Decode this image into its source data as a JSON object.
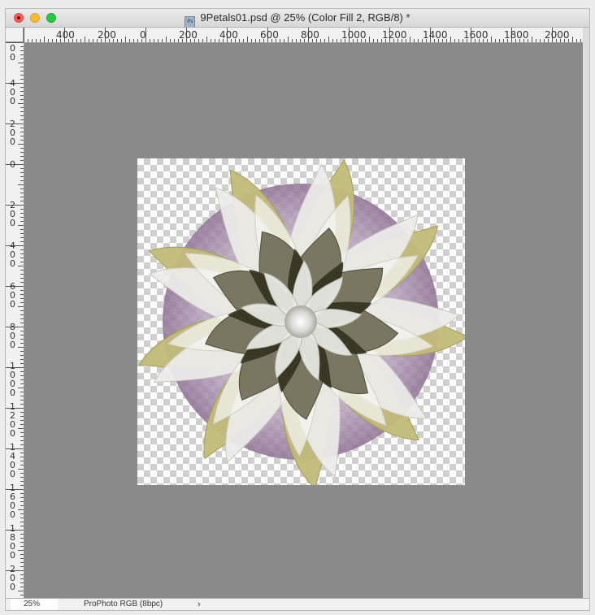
{
  "window": {
    "title": "9Petals01.psd @ 25% (Color Fill 2, RGB/8) *",
    "doc_icon": "photoshop-document-icon"
  },
  "ruler_horizontal": [
    "400",
    "200",
    "0",
    "200",
    "400",
    "600",
    "800",
    "1000",
    "1200",
    "1400",
    "1600",
    "1800",
    "2000"
  ],
  "ruler_vertical": [
    "00",
    "400",
    "200",
    "0",
    "200",
    "400",
    "600",
    "800",
    "1000",
    "1200",
    "1400",
    "1600",
    "1800",
    "200"
  ],
  "statusbar": {
    "zoom": "25%",
    "color_profile": "ProPhoto RGB (8bpc)",
    "chevron": "›"
  },
  "colors": {
    "canvas_background": "#8a8a8a",
    "purple_back_petals": "#9b80a0",
    "olive_mid_petals": "#6d6a52",
    "light_petals": "#eaeaea",
    "gold_outline": "#b8b168"
  }
}
